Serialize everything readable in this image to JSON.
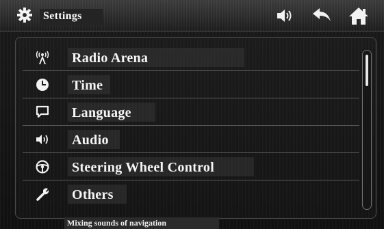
{
  "header": {
    "title": "Settings",
    "icons": {
      "settings": "gear-icon",
      "volume": "speaker-icon",
      "back": "back-arrow-icon",
      "home": "home-icon"
    }
  },
  "menu": {
    "items": [
      {
        "label": "Radio Arena",
        "icon": "radio-antenna-icon"
      },
      {
        "label": "Time",
        "icon": "clock-icon"
      },
      {
        "label": "Language",
        "icon": "speech-bubble-icon"
      },
      {
        "label": "Audio",
        "icon": "speaker-icon"
      },
      {
        "label": "Steering Wheel Control",
        "icon": "steering-wheel-icon"
      },
      {
        "label": "Others",
        "icon": "wrench-icon"
      }
    ]
  },
  "status": {
    "text": "Mixing sounds of navigation"
  },
  "colors": {
    "background": "#121212",
    "text": "#f5f5f5",
    "divider": "#5a5a5a"
  }
}
